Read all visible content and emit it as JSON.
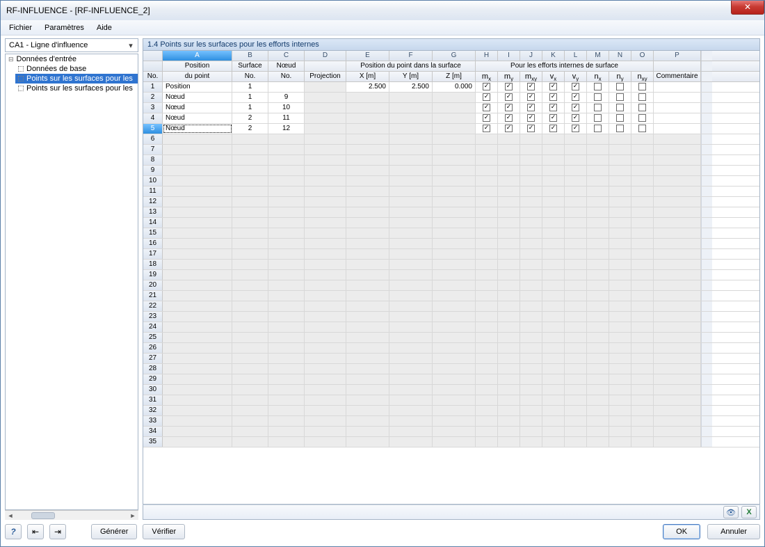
{
  "window": {
    "title": "RF-INFLUENCE - [RF-INFLUENCE_2]"
  },
  "menu": {
    "file": "Fichier",
    "params": "Paramètres",
    "help": "Aide"
  },
  "sidebar": {
    "combo": "CA1 - Ligne d'influence",
    "root": "Données d'entrée",
    "items": [
      "Données de base",
      "Points sur les surfaces pour les",
      "Points sur les surfaces pour les"
    ],
    "selected": 1
  },
  "panel_title": "1.4 Points sur les surfaces pour les efforts internes",
  "columns": {
    "letters": [
      "A",
      "B",
      "C",
      "D",
      "E",
      "F",
      "G",
      "H",
      "I",
      "J",
      "K",
      "L",
      "M",
      "N",
      "O",
      "P"
    ],
    "group_no": "No.",
    "group_a_top": "Position",
    "group_a_bot": "du point",
    "group_b_top": "Surface",
    "group_b_bot": "No.",
    "group_c_top": "Nœud",
    "group_c_bot": "No.",
    "group_d": "Projection",
    "group_efg_top": "Position du point dans la surface",
    "e": "X [m]",
    "f": "Y [m]",
    "g": "Z [m]",
    "group_forces_top": "Pour les efforts internes de surface",
    "h": "m",
    "h_sub": "x",
    "i": "m",
    "i_sub": "y",
    "j": "m",
    "j_sub": "xy",
    "k": "v",
    "k_sub": "x",
    "l": "v",
    "l_sub": "y",
    "m": "n",
    "m_sub": "x",
    "n": "n",
    "n_sub": "y",
    "o": "n",
    "o_sub": "xy",
    "p": "Commentaire"
  },
  "rows": [
    {
      "no": 1,
      "a": "Position",
      "b": "1",
      "c": "",
      "d": "",
      "e": "2.500",
      "f": "2.500",
      "g": "0.000",
      "h": true,
      "i": true,
      "j": true,
      "k": true,
      "l": true,
      "m": false,
      "n": false,
      "o": false,
      "p": ""
    },
    {
      "no": 2,
      "a": "Nœud",
      "b": "1",
      "c": "9",
      "d": "",
      "e": "",
      "f": "",
      "g": "",
      "h": true,
      "i": true,
      "j": true,
      "k": true,
      "l": true,
      "m": false,
      "n": false,
      "o": false,
      "p": ""
    },
    {
      "no": 3,
      "a": "Nœud",
      "b": "1",
      "c": "10",
      "d": "",
      "e": "",
      "f": "",
      "g": "",
      "h": true,
      "i": true,
      "j": true,
      "k": true,
      "l": true,
      "m": false,
      "n": false,
      "o": false,
      "p": ""
    },
    {
      "no": 4,
      "a": "Nœud",
      "b": "2",
      "c": "11",
      "d": "",
      "e": "",
      "f": "",
      "g": "",
      "h": true,
      "i": true,
      "j": true,
      "k": true,
      "l": true,
      "m": false,
      "n": false,
      "o": false,
      "p": ""
    },
    {
      "no": 5,
      "a": "Nœud",
      "b": "2",
      "c": "12",
      "d": "",
      "e": "",
      "f": "",
      "g": "",
      "h": true,
      "i": true,
      "j": true,
      "k": true,
      "l": true,
      "m": false,
      "n": false,
      "o": false,
      "p": ""
    }
  ],
  "total_rows": 35,
  "buttons": {
    "generate": "Générer",
    "verify": "Vérifier",
    "ok": "OK",
    "cancel": "Annuler"
  },
  "selected_row": 5,
  "selected_col": 0
}
